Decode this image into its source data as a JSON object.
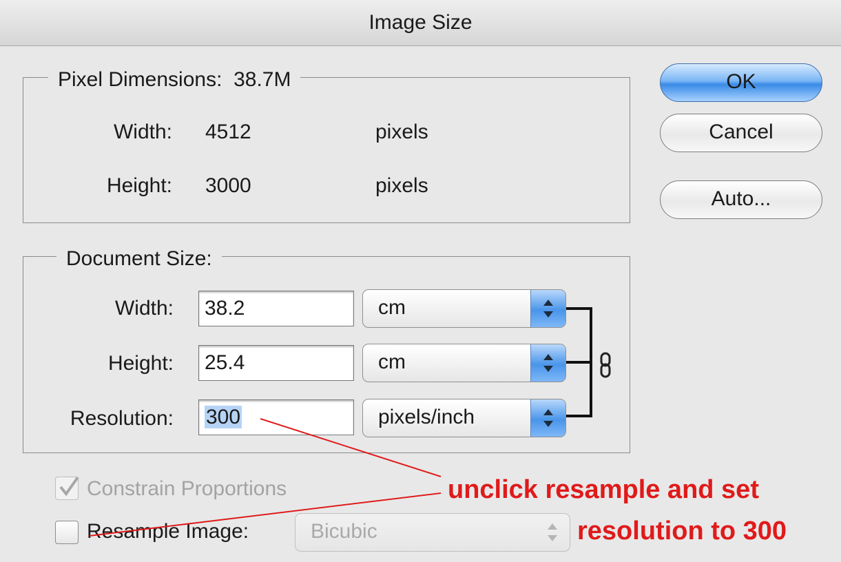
{
  "dialog": {
    "title": "Image Size"
  },
  "buttons": {
    "ok": "OK",
    "cancel": "Cancel",
    "auto": "Auto..."
  },
  "pixel_dimensions": {
    "legend": "Pixel Dimensions:",
    "size": "38.7M",
    "width": {
      "label": "Width:",
      "value": "4512",
      "unit": "pixels"
    },
    "height": {
      "label": "Height:",
      "value": "3000",
      "unit": "pixels"
    }
  },
  "document_size": {
    "legend": "Document Size:",
    "width": {
      "label": "Width:",
      "value": "38.2",
      "unit": "cm"
    },
    "height": {
      "label": "Height:",
      "value": "25.4",
      "unit": "cm"
    },
    "resolution": {
      "label": "Resolution:",
      "value": "300",
      "unit": "pixels/inch"
    }
  },
  "options": {
    "constrain": {
      "label": "Constrain Proportions",
      "checked": true,
      "enabled": false
    },
    "resample": {
      "label": "Resample Image:",
      "checked": false,
      "method": "Bicubic"
    }
  },
  "annotation": {
    "line1": "unclick resample and set",
    "line2": "resolution to 300",
    "color": "#e01a1a"
  },
  "icons": [
    "chain-link-icon",
    "checkmark-icon",
    "stepper-arrows-icon"
  ]
}
